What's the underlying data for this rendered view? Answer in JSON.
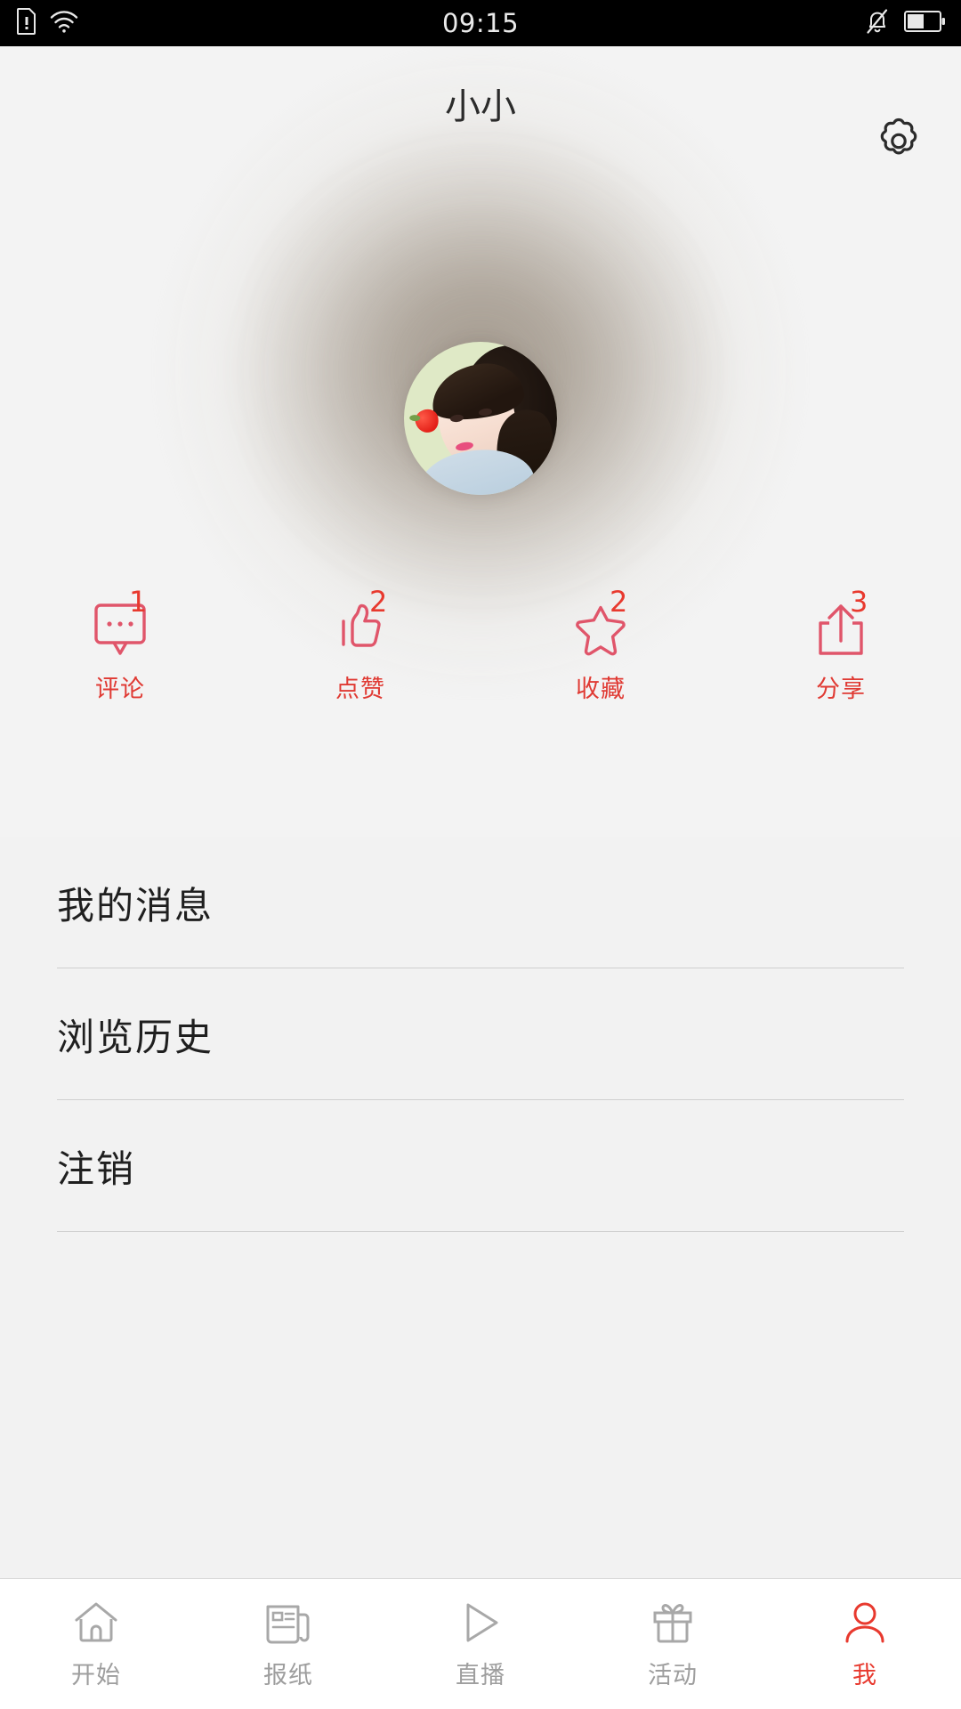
{
  "status_bar": {
    "time": "09:15",
    "left_icons": [
      "sim-card-alert-icon",
      "wifi-icon"
    ],
    "right_icons": [
      "notifications-muted-icon",
      "battery-icon"
    ],
    "background_color": "#000000"
  },
  "header": {
    "title": "小小",
    "settings_icon": "gear-icon",
    "avatar_alt": "user-avatar-photo"
  },
  "stats": {
    "accent_color": "#e03a33",
    "items": [
      {
        "icon": "comment-icon",
        "count": "1",
        "label": "评论"
      },
      {
        "icon": "thumbs-up-icon",
        "count": "2",
        "label": "点赞"
      },
      {
        "icon": "star-icon",
        "count": "2",
        "label": "收藏"
      },
      {
        "icon": "share-icon",
        "count": "3",
        "label": "分享"
      }
    ]
  },
  "menu": {
    "items": [
      {
        "label": "我的消息"
      },
      {
        "label": "浏览历史"
      },
      {
        "label": "注销"
      }
    ]
  },
  "tabbar": {
    "active_color": "#e8392e",
    "inactive_color": "#9e9e9e",
    "items": [
      {
        "icon": "home-icon",
        "label": "开始",
        "active": false
      },
      {
        "icon": "newspaper-icon",
        "label": "报纸",
        "active": false
      },
      {
        "icon": "play-icon",
        "label": "直播",
        "active": false
      },
      {
        "icon": "gift-icon",
        "label": "活动",
        "active": false
      },
      {
        "icon": "person-icon",
        "label": "我",
        "active": true
      }
    ]
  }
}
